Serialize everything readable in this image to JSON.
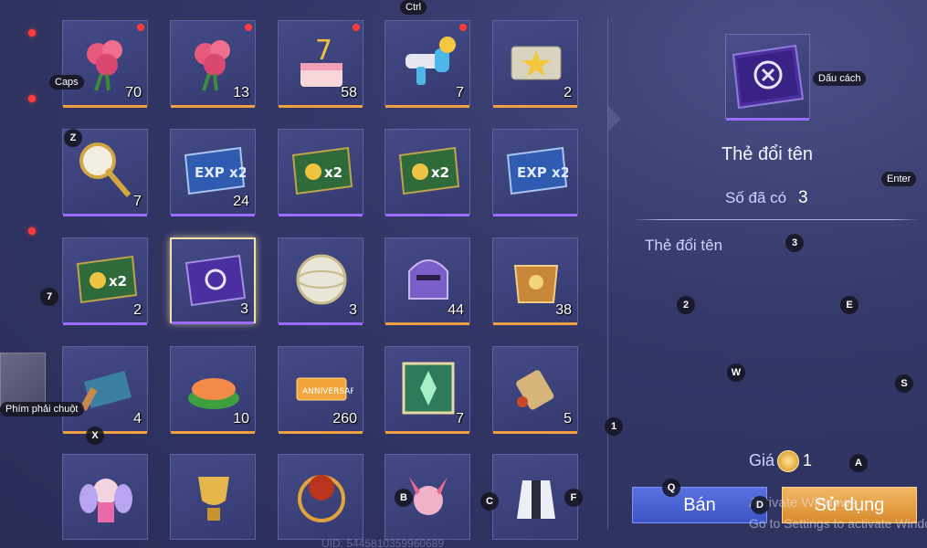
{
  "inventory": {
    "items": [
      {
        "name": "rose-bouquet-small",
        "count": "70",
        "rarity": "orange",
        "dot": true
      },
      {
        "name": "rose-bouquet-large",
        "count": "13",
        "rarity": "orange",
        "dot": true
      },
      {
        "name": "birthday-cake",
        "count": "58",
        "rarity": "orange",
        "dot": true
      },
      {
        "name": "toy-blaster",
        "count": "7",
        "rarity": "orange",
        "dot": true
      },
      {
        "name": "gold-star-ticket",
        "count": "2",
        "rarity": "orange",
        "dot": false
      },
      {
        "name": "golden-scepter",
        "count": "7",
        "rarity": "purple",
        "dot": false
      },
      {
        "name": "exp-x2-card",
        "count": "24",
        "rarity": "purple",
        "dot": false
      },
      {
        "name": "gold-x2-card",
        "count": "",
        "rarity": "purple",
        "dot": false
      },
      {
        "name": "gold-x2-card",
        "count": "",
        "rarity": "purple",
        "dot": false
      },
      {
        "name": "exp-x2-card",
        "count": "",
        "rarity": "purple",
        "dot": false
      },
      {
        "name": "gold-x2-card",
        "count": "2",
        "rarity": "purple",
        "dot": false
      },
      {
        "name": "rename-card",
        "count": "3",
        "rarity": "purple",
        "dot": false,
        "selected": true
      },
      {
        "name": "silver-orb",
        "count": "3",
        "rarity": "purple",
        "dot": false
      },
      {
        "name": "knight-helmet",
        "count": "44",
        "rarity": "orange",
        "dot": false
      },
      {
        "name": "golden-armor",
        "count": "38",
        "rarity": "orange",
        "dot": false
      },
      {
        "name": "treasure-map",
        "count": "4",
        "rarity": "orange",
        "dot": false
      },
      {
        "name": "salmon-sushi",
        "count": "10",
        "rarity": "orange",
        "dot": false
      },
      {
        "name": "anniversary-ticket",
        "count": "260",
        "rarity": "orange",
        "dot": false
      },
      {
        "name": "emblem-card",
        "count": "7",
        "rarity": "orange",
        "dot": false
      },
      {
        "name": "scroll",
        "count": "5",
        "rarity": "orange",
        "dot": false
      },
      {
        "name": "fairy-avatar",
        "count": "",
        "rarity": "none",
        "dot": false
      },
      {
        "name": "golden-trophy",
        "count": "",
        "rarity": "none",
        "dot": false
      },
      {
        "name": "fire-ring",
        "count": "",
        "rarity": "none",
        "dot": false
      },
      {
        "name": "pink-creature",
        "count": "",
        "rarity": "none",
        "dot": false
      },
      {
        "name": "warrior-costume",
        "count": "",
        "rarity": "none",
        "dot": false
      }
    ]
  },
  "detail": {
    "title": "Thẻ đổi tên",
    "owned_label": "Số đã có",
    "owned_value": "3",
    "description": "Thẻ đổi tên",
    "price_label": "Giá",
    "price_value": "1",
    "sell_label": "Bán",
    "use_label": "Sử dụng"
  },
  "overlay_keys": {
    "ctrl": "Ctrl",
    "caps": "Caps",
    "space": "Dấu cách",
    "enter": "Enter",
    "right_click": "Phím phải chuột",
    "z": "Z",
    "seven": "7",
    "x": "X",
    "three": "3",
    "two": "2",
    "e": "E",
    "w": "W",
    "s": "S",
    "one": "1",
    "a": "A",
    "q": "Q",
    "d": "D",
    "b": "B",
    "c": "C",
    "f": "F"
  },
  "watermark": {
    "line1": "Activate Windows",
    "line2": "Go to Settings to activate Windows."
  },
  "uid": "UID: 5445810359960689",
  "colors": {
    "orange_bar": "#f0a040",
    "purple_bar": "#9b6cff",
    "sell": "#4a62d4",
    "use": "#e8a24a"
  }
}
